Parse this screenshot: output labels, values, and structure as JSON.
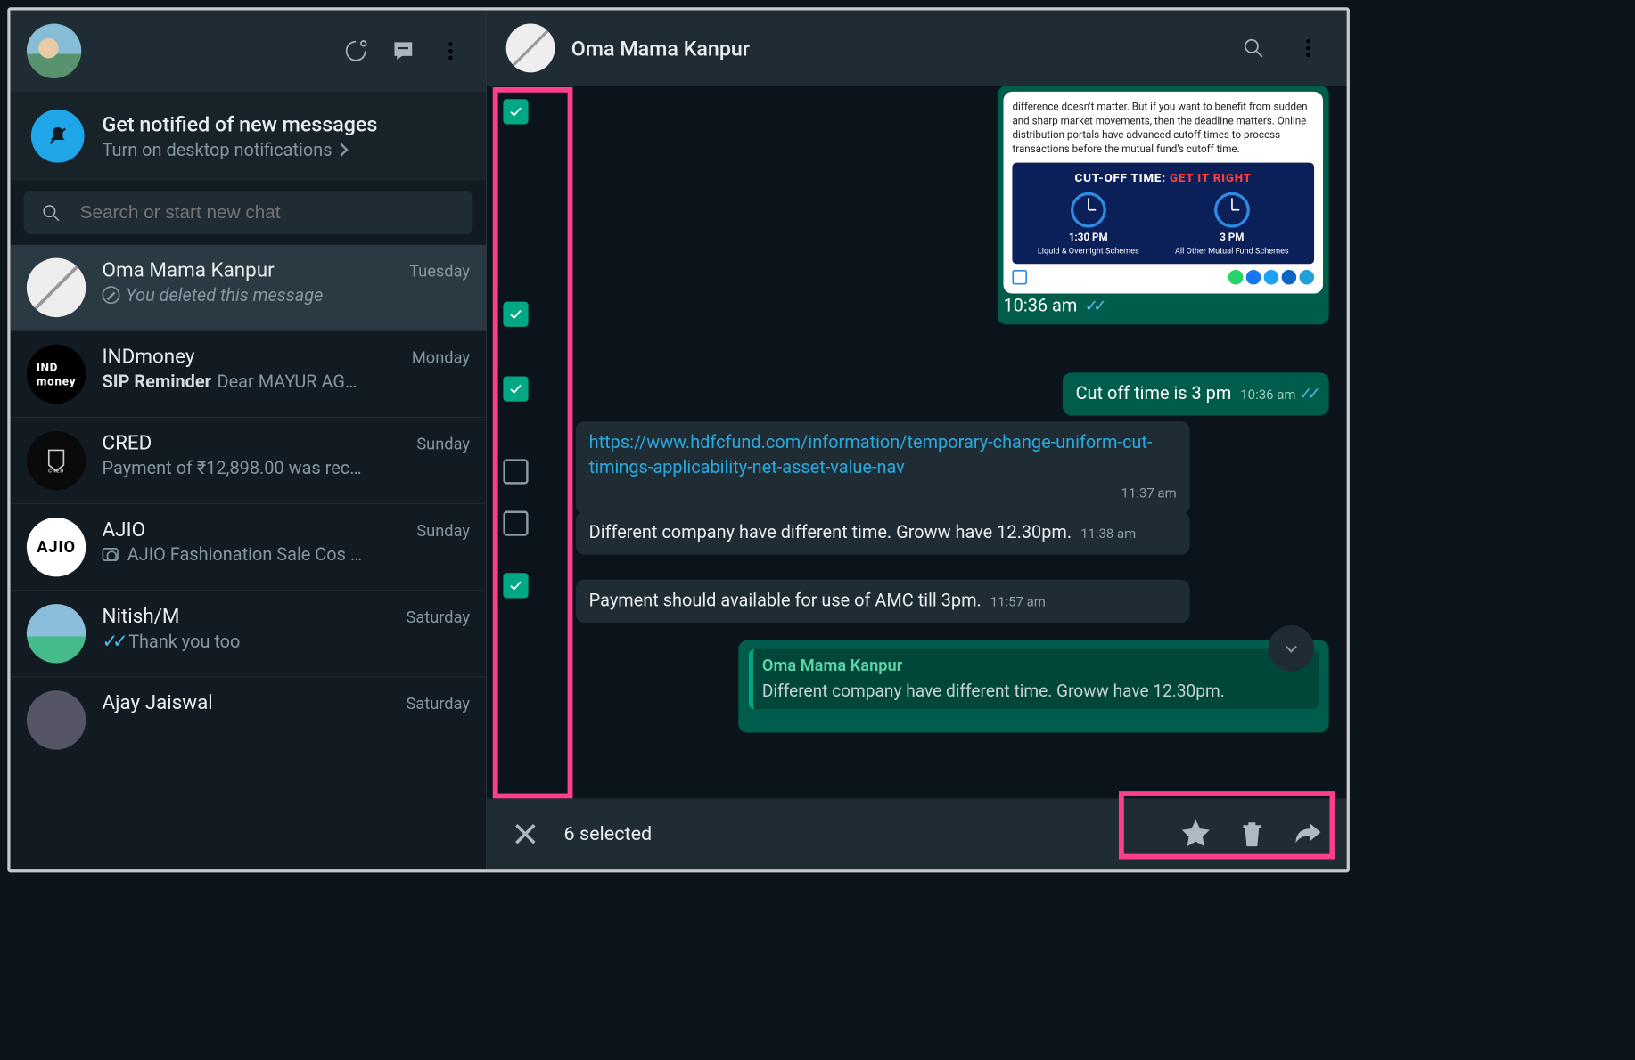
{
  "header": {
    "contact_name": "Oma Mama Kanpur"
  },
  "notifications": {
    "title": "Get notified of new messages",
    "subtitle": "Turn on desktop notifications"
  },
  "search": {
    "placeholder": "Search or start new chat"
  },
  "chats": [
    {
      "name": "Oma Mama Kanpur",
      "date": "Tuesday",
      "preview": "You deleted this message",
      "type": "deleted"
    },
    {
      "name": "INDmoney",
      "date": "Monday",
      "preview_prefix": "SIP Reminder",
      "preview": "Dear MAYUR AG…"
    },
    {
      "name": "CRED",
      "date": "Sunday",
      "preview": "Payment of ₹12,898.00 was rec…"
    },
    {
      "name": "AJIO",
      "date": "Sunday",
      "preview": "AJIO Fashionation Sale  Cos …",
      "icon": "camera"
    },
    {
      "name": "Nitish/M",
      "date": "Saturday",
      "preview": "Thank you too",
      "icon": "ticks"
    },
    {
      "name": "Ajay Jaiswal",
      "date": "Saturday",
      "preview": ""
    }
  ],
  "checkboxes": [
    true,
    true,
    true,
    false,
    false,
    true
  ],
  "checkbox_heights": [
    316,
    116,
    128,
    80,
    96,
    220
  ],
  "messages": {
    "m1_card": {
      "text": "difference doesn't matter. But if you want to benefit from sudden and sharp market movements, then the deadline matters. Online distribution portals have advanced cutoff times to process transactions before the mutual fund's cutoff time.",
      "banner_title": "CUT-OFF TIME:",
      "banner_title2": "GET IT RIGHT",
      "left_time": "1:30 PM",
      "left_label": "Liquid & Overnight Schemes",
      "right_time": "3 PM",
      "right_label": "All Other Mutual Fund Schemes",
      "time": "10:36 am"
    },
    "m2": {
      "text": "Cut off time is 3 pm",
      "time": "10:36 am"
    },
    "m3": {
      "url": "https://www.hdfcfund.com/information/temporary-change-uniform-cut-timings-applicability-net-asset-value-nav",
      "time": "11:37 am"
    },
    "m4": {
      "text": "Different company have different time. Groww have 12.30pm.",
      "time": "11:38 am"
    },
    "m5": {
      "text": "Payment should available for use of AMC till 3pm.",
      "time": "11:57 am"
    },
    "m6": {
      "quoted_name": "Oma Mama Kanpur",
      "quoted_text": "Different company have different time. Groww have 12.30pm."
    }
  },
  "selection_bar": {
    "count_label": "6 selected"
  }
}
